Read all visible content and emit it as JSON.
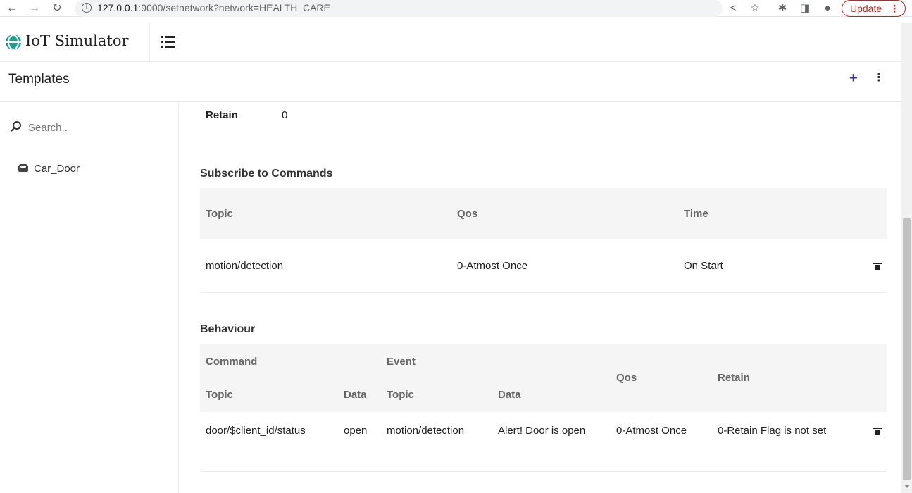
{
  "browser": {
    "url_host": "127.0.0.1",
    "url_rest": ":9000/setnetwork?network=HEALTH_CARE",
    "update_label": "Update"
  },
  "app": {
    "brand": "IoT Simulator"
  },
  "templates": {
    "title": "Templates"
  },
  "sidebar": {
    "search_placeholder": "Search..",
    "items": [
      {
        "label": "Car_Door",
        "icon": "car-icon"
      }
    ]
  },
  "main": {
    "publish_partial": {
      "retain_label": "Retain",
      "retain_value": "0"
    },
    "subscribe": {
      "title": "Subscribe to Commands",
      "headers": [
        "Topic",
        "Qos",
        "Time"
      ],
      "rows": [
        {
          "topic": "motion/detection",
          "qos": "0-Atmost Once",
          "time": "On Start"
        }
      ]
    },
    "behaviour": {
      "title": "Behaviour",
      "group_headers": {
        "command": "Command",
        "event": "Event",
        "qos": "Qos",
        "retain": "Retain"
      },
      "sub_headers": {
        "cmd_topic": "Topic",
        "cmd_data": "Data",
        "evt_topic": "Topic",
        "evt_data": "Data"
      },
      "rows": [
        {
          "cmd_topic": "door/$client_id/status",
          "cmd_data": "open",
          "evt_topic": "motion/detection",
          "evt_data": "Alert! Door is open",
          "qos": "0-Atmost Once",
          "retain": "0-Retain Flag is not set"
        }
      ]
    }
  }
}
